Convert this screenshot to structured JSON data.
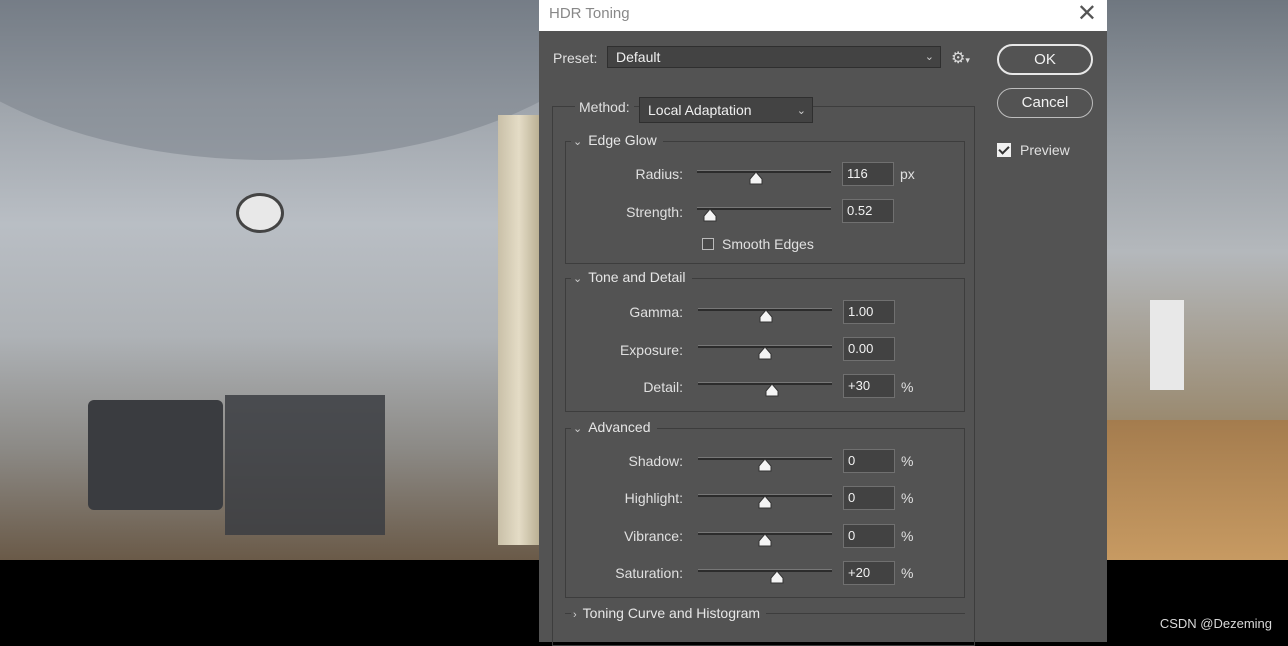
{
  "window": {
    "title": "HDR Toning"
  },
  "preset": {
    "label": "Preset:",
    "value": "Default"
  },
  "buttons": {
    "ok": "OK",
    "cancel": "Cancel"
  },
  "preview": {
    "label": "Preview",
    "checked": true
  },
  "method": {
    "label": "Method:",
    "value": "Local Adaptation"
  },
  "edge_glow": {
    "title": "Edge Glow",
    "radius": {
      "label": "Radius:",
      "value": "116",
      "unit": "px",
      "slider_fraction": 0.44
    },
    "strength": {
      "label": "Strength:",
      "value": "0.52",
      "slider_fraction": 0.1
    },
    "smooth_edges": {
      "label": "Smooth Edges",
      "checked": false
    }
  },
  "tone_detail": {
    "title": "Tone and Detail",
    "gamma": {
      "label": "Gamma:",
      "value": "1.00",
      "slider_fraction": 0.51
    },
    "exposure": {
      "label": "Exposure:",
      "value": "0.00",
      "slider_fraction": 0.5
    },
    "detail": {
      "label": "Detail:",
      "value": "+30",
      "unit": "%",
      "slider_fraction": 0.55
    }
  },
  "advanced": {
    "title": "Advanced",
    "shadow": {
      "label": "Shadow:",
      "value": "0",
      "unit": "%",
      "slider_fraction": 0.5
    },
    "highlight": {
      "label": "Highlight:",
      "value": "0",
      "unit": "%",
      "slider_fraction": 0.5
    },
    "vibrance": {
      "label": "Vibrance:",
      "value": "0",
      "unit": "%",
      "slider_fraction": 0.5
    },
    "saturation": {
      "label": "Saturation:",
      "value": "+20",
      "unit": "%",
      "slider_fraction": 0.59
    }
  },
  "toning_curve": {
    "title": "Toning Curve and Histogram"
  },
  "watermark": "CSDN @Dezeming"
}
